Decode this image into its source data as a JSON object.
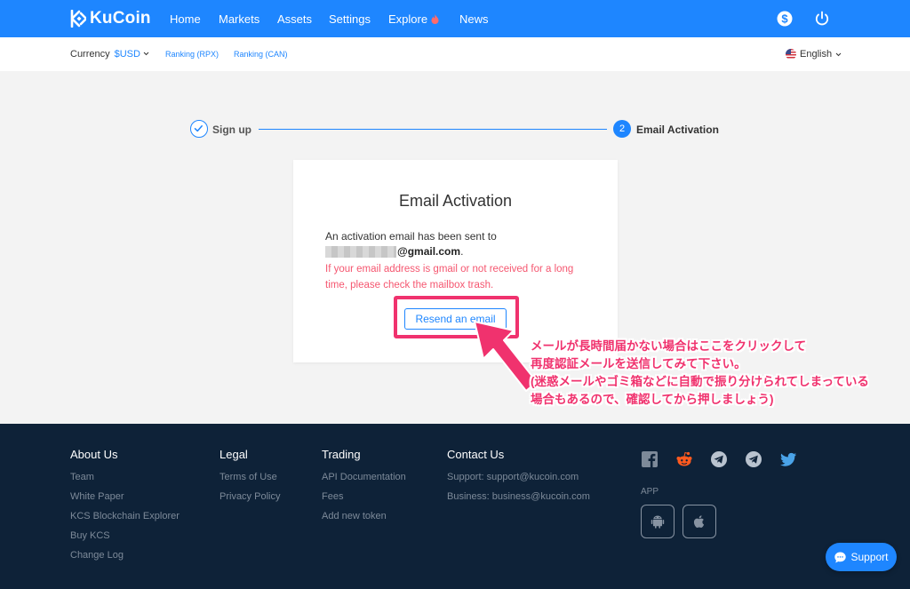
{
  "brand": {
    "name": "KuCoin",
    "accent": "#1e86ff",
    "annotation_color": "#f0326e",
    "warning_color": "#f55770"
  },
  "nav": {
    "home": "Home",
    "markets": "Markets",
    "assets": "Assets",
    "settings": "Settings",
    "explore": "Explore",
    "news": "News"
  },
  "subbar": {
    "currency_label": "Currency",
    "currency_value": "$USD",
    "ranking_rpx": "Ranking (RPX)",
    "ranking_can": "Ranking (CAN)",
    "language": "English"
  },
  "stepper": {
    "step1_label": "Sign up",
    "step2_number": "2",
    "step2_label": "Email Activation"
  },
  "card": {
    "title": "Email Activation",
    "sent_text": "An activation email has been sent to",
    "email_suffix": "@gmail.com",
    "email_period": ".",
    "warning": "If your email address is gmail or not received for a long time, please check the mailbox trash.",
    "resend_label": "Resend an email"
  },
  "annotation": {
    "line1": "メールが長時間届かない場合はここをクリックして",
    "line2": "再度認証メールを送信してみて下さい。",
    "line3": "(迷惑メールやゴミ箱などに自動で振り分けられてしまっている",
    "line4": "場合もあるので、確認してから押しましょう)"
  },
  "footer": {
    "about": {
      "title": "About Us",
      "links": [
        "Team",
        "White Paper",
        "KCS Blockchain Explorer",
        "Buy KCS",
        "Change Log"
      ]
    },
    "legal": {
      "title": "Legal",
      "links": [
        "Terms of Use",
        "Privacy Policy"
      ]
    },
    "trading": {
      "title": "Trading",
      "links": [
        "API Documentation",
        "Fees",
        "Add new token"
      ]
    },
    "contact": {
      "title": "Contact Us",
      "support": "Support:  support@kucoin.com",
      "business": "Business:  business@kucoin.com"
    },
    "app_label": "APP",
    "social_icons": [
      "facebook-icon",
      "reddit-icon",
      "telegram-icon",
      "telegram-icon",
      "twitter-icon"
    ]
  },
  "support_button": "Support"
}
